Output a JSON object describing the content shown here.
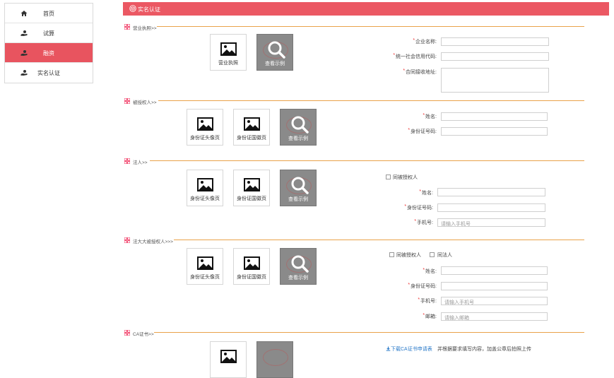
{
  "sidebar": {
    "items": [
      {
        "label": "首页",
        "icon": "home-icon"
      },
      {
        "label": "试算",
        "icon": "hand-coin-icon"
      },
      {
        "label": "融资",
        "icon": "hand-coin-icon"
      },
      {
        "label": "实名认证",
        "icon": "hand-coin-icon"
      }
    ],
    "active_index": 2,
    "active_color": "#e8545f"
  },
  "header": {
    "title": "实名认证",
    "icon": "cube-icon",
    "color": "#eb5863"
  },
  "sections": {
    "license": {
      "title": "营业执照>>",
      "upload_label": "营业执照",
      "example_label": "查看示例",
      "fields": {
        "company_name": "企业名称:",
        "credit_code": "统一社会信用代码:",
        "contract_address": "合同接收地址:"
      }
    },
    "authorized": {
      "title": "被授权人>>",
      "front_label": "身份证头像页",
      "back_label": "身份证国徽页",
      "example_label": "查看示例",
      "fields": {
        "name": "姓名:",
        "id_number": "身份证号码:"
      }
    },
    "legal": {
      "title": "法人>>",
      "front_label": "身份证头像页",
      "back_label": "身份证国徽页",
      "example_label": "查看示例",
      "same_as_authorized": "同被授权人",
      "fields": {
        "name": "姓名:",
        "id_number": "身份证号码:",
        "phone": "手机号:"
      },
      "phone_placeholder": "请输入手机号"
    },
    "spouse": {
      "title": "法大大被授权人>>>",
      "front_label": "身份证头像页",
      "back_label": "身份证国徽页",
      "example_label": "查看示例",
      "same_as_authorized": "同被授权人",
      "same_as_legal": "同法人",
      "fields": {
        "name": "姓名:",
        "id_number": "身份证号码:",
        "phone": "手机号:",
        "email": "邮箱:"
      },
      "phone_placeholder": "请输入手机号",
      "email_placeholder": "请输入邮箱"
    },
    "ca": {
      "title": "CA证书>>",
      "download_link": "下载CA证书申请表",
      "download_note": "并根据要求填写内容，加盖公章后拍照上传"
    }
  },
  "colors": {
    "section_line": "#e9a24a",
    "required": "#e33333"
  }
}
